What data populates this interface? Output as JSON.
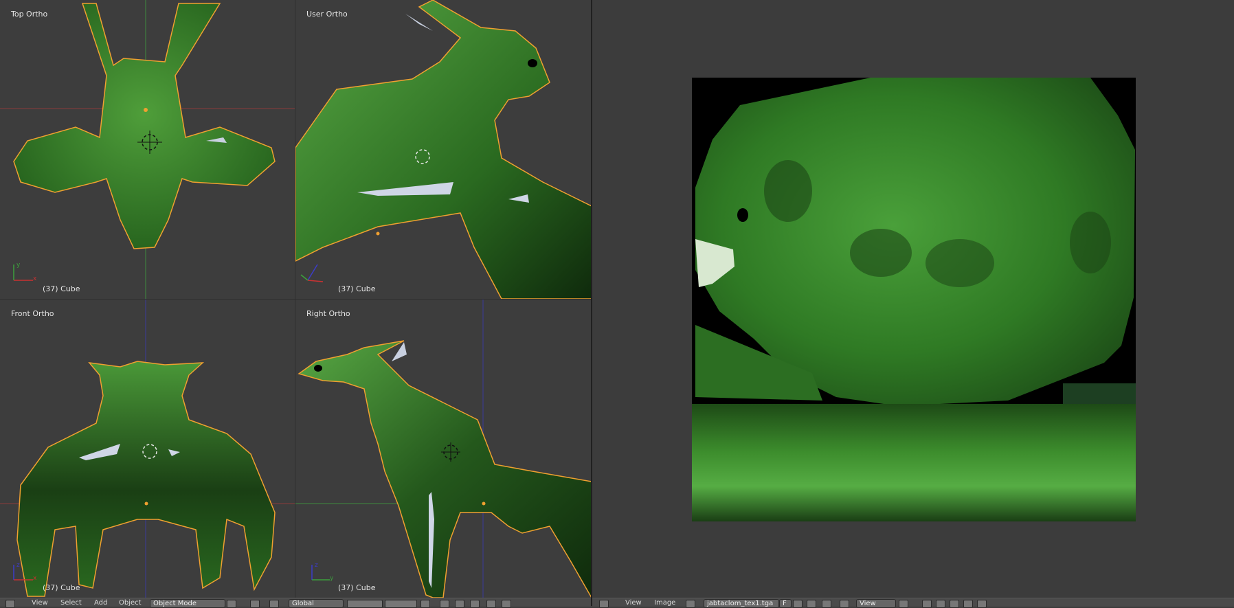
{
  "viewports": {
    "top_left": {
      "label": "Top Ortho",
      "object": "(37) Cube"
    },
    "top_right": {
      "label": "User Ortho",
      "object": "(37) Cube"
    },
    "bottom_left": {
      "label": "Front Ortho",
      "object": "(37) Cube"
    },
    "bottom_right": {
      "label": "Right Ortho",
      "object": "(37) Cube"
    }
  },
  "header_3d": {
    "menus": [
      "View",
      "Select",
      "Add",
      "Object"
    ],
    "mode": "Object Mode",
    "orientation": "Global"
  },
  "header_image": {
    "menus": [
      "View",
      "Image"
    ],
    "image_name": "jabtaclom_tex1.tga",
    "image_users": "F",
    "view_mode": "View"
  },
  "colors": {
    "viewport_bg": "#3d3d3d",
    "model_green": "#3c8c2c",
    "selection_outline": "#f0a030",
    "axis_x": "#c83232",
    "axis_y": "#3ca03c",
    "axis_z": "#3c3cc8"
  }
}
